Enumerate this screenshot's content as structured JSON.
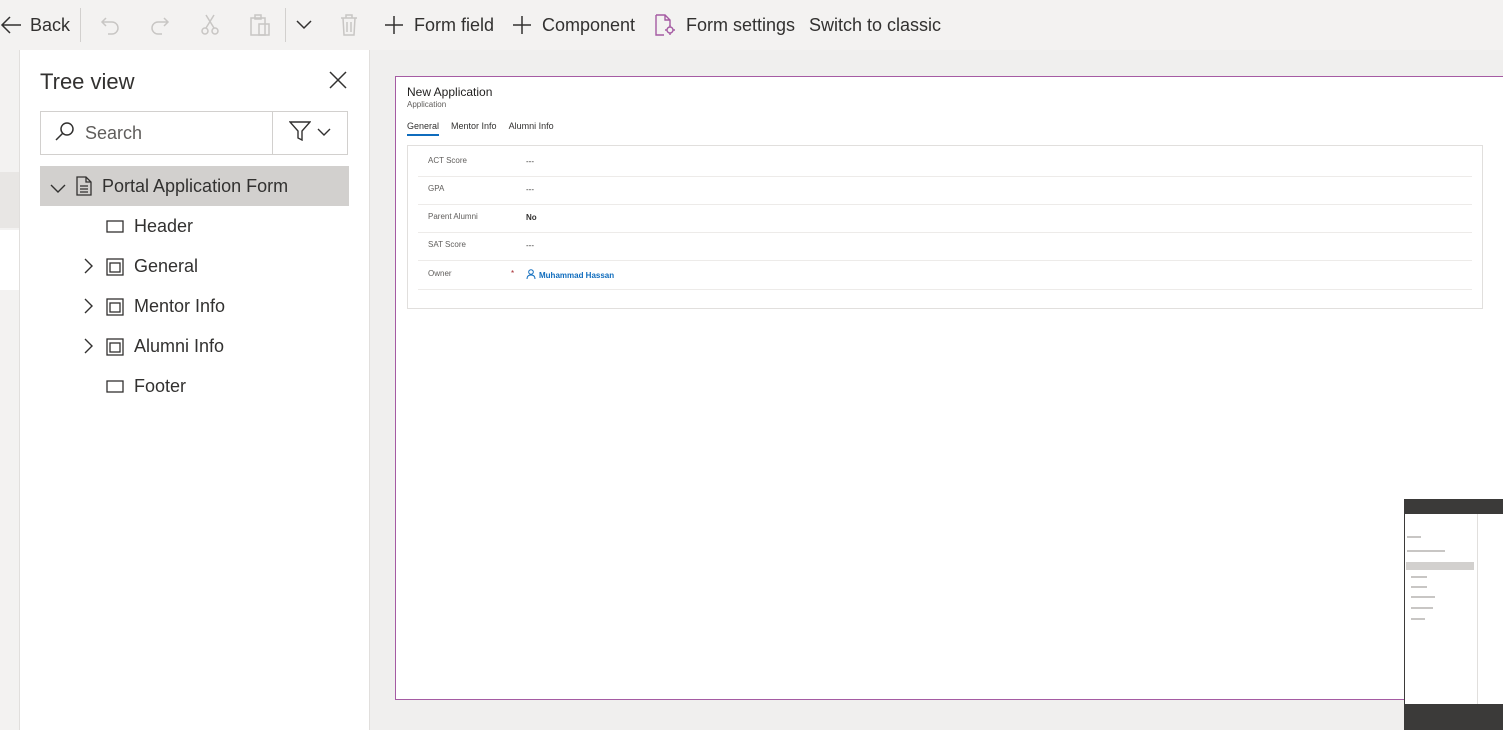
{
  "toolbar": {
    "back_label": "Back",
    "form_field_label": "Form field",
    "component_label": "Component",
    "form_settings_label": "Form settings",
    "switch_classic_label": "Switch to classic"
  },
  "tree": {
    "title": "Tree view",
    "search_placeholder": "Search",
    "root_label": "Portal Application Form",
    "items": [
      {
        "label": "Header",
        "icon": "header-icon",
        "expandable": false
      },
      {
        "label": "General",
        "icon": "tab-icon",
        "expandable": true
      },
      {
        "label": "Mentor Info",
        "icon": "tab-icon",
        "expandable": true
      },
      {
        "label": "Alumni Info",
        "icon": "tab-icon",
        "expandable": true
      },
      {
        "label": "Footer",
        "icon": "footer-icon",
        "expandable": false
      }
    ]
  },
  "form": {
    "title": "New Application",
    "subtitle": "Application",
    "tabs": [
      "General",
      "Mentor Info",
      "Alumni Info"
    ],
    "active_tab": "General",
    "fields": [
      {
        "label": "ACT Score",
        "value": "---",
        "required": false
      },
      {
        "label": "GPA",
        "value": "---",
        "required": false
      },
      {
        "label": "Parent Alumni",
        "value": "No",
        "required": false
      },
      {
        "label": "SAT Score",
        "value": "---",
        "required": false
      },
      {
        "label": "Owner",
        "value": "Muhammad Hassan",
        "required": true,
        "required_mark": "*"
      }
    ]
  },
  "colors": {
    "accent": "#a55ba3",
    "link": "#0f6cbd",
    "required": "#a4262c",
    "selected_row": "#d2d0ce"
  }
}
